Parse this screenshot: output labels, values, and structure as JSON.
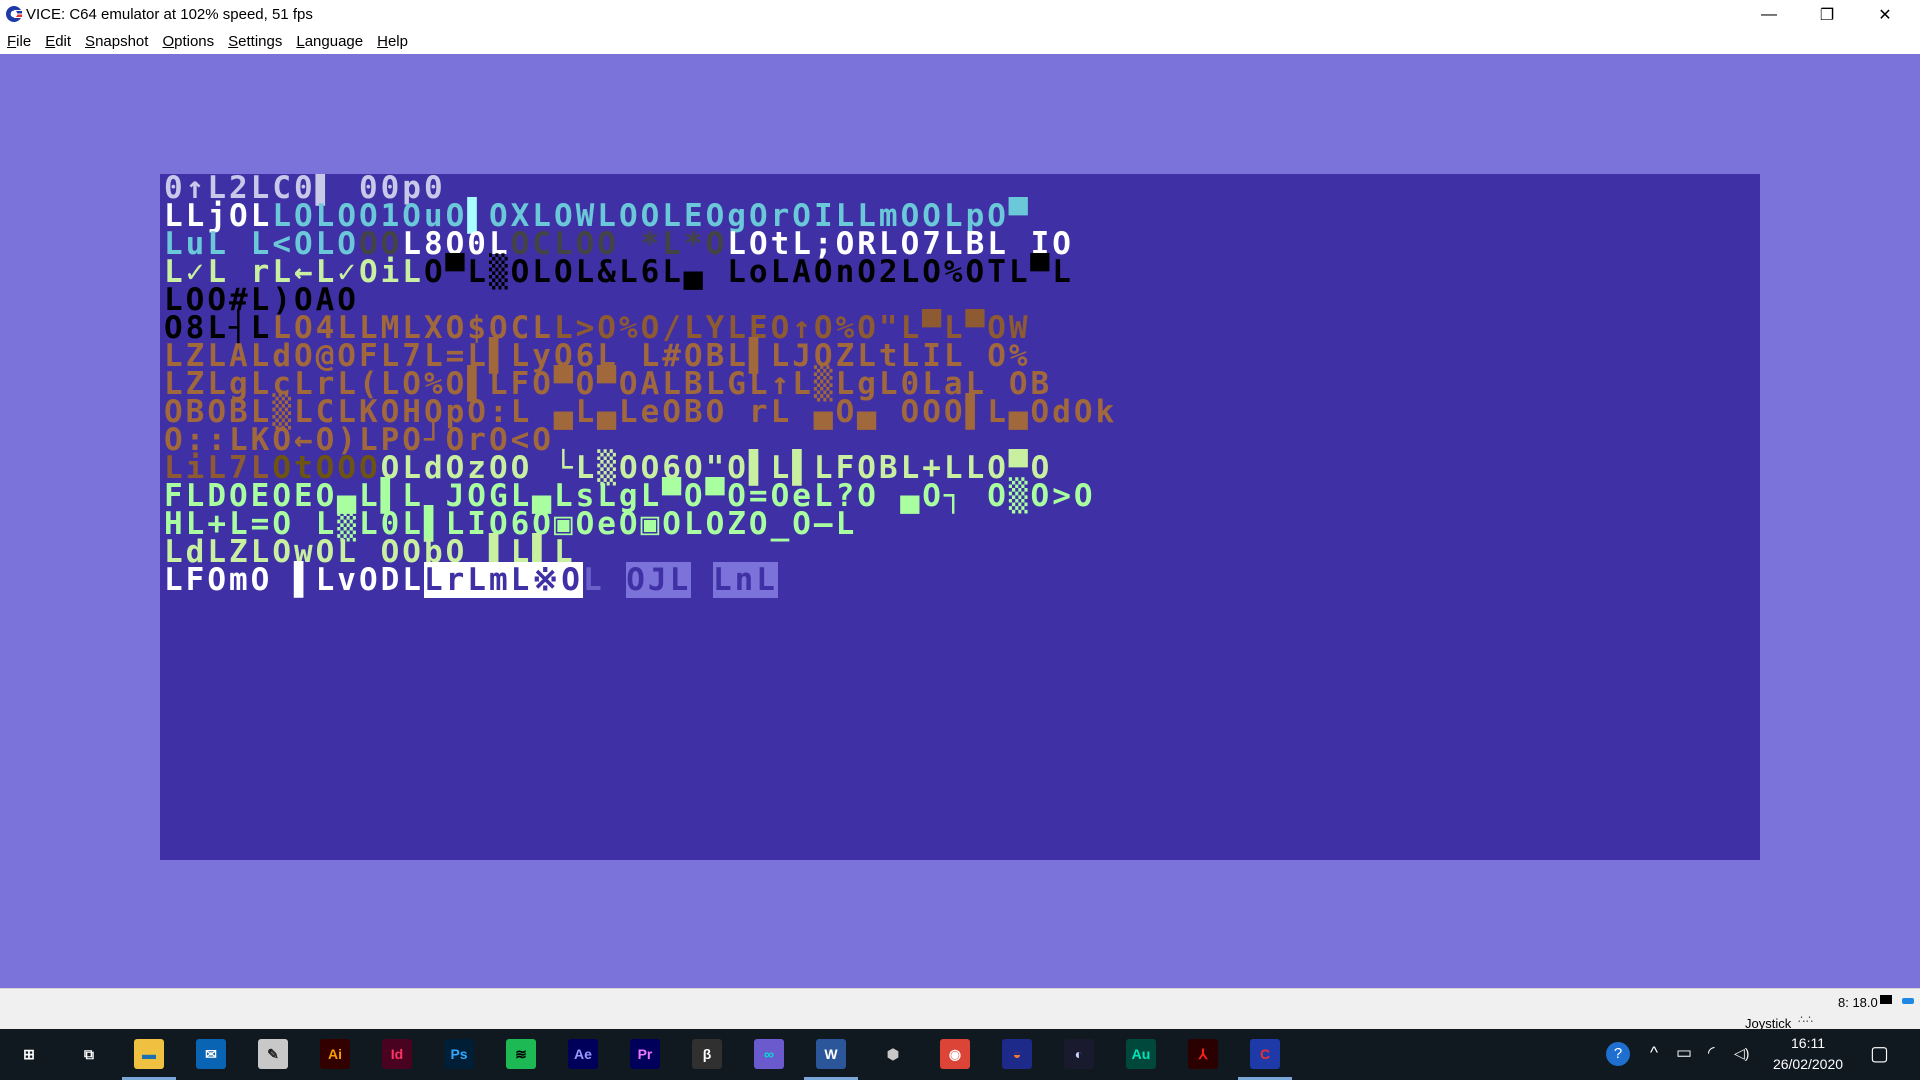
{
  "window": {
    "title": "VICE: C64 emulator at 102% speed, 51 fps",
    "icon": "vice-c64-icon",
    "controls": [
      "minimize-icon",
      "restore-icon",
      "close-icon"
    ],
    "minimize_glyph": "—",
    "restore_glyph": "❐",
    "close_glyph": "✕"
  },
  "menu": {
    "items": [
      "File",
      "Edit",
      "Snapshot",
      "Options",
      "Settings",
      "Language",
      "Help"
    ],
    "mnemonics": [
      "F",
      "E",
      "S",
      "O",
      "S",
      "L",
      "H"
    ]
  },
  "colors": {
    "border": "#7b72da",
    "screen_bg": "#3f31a5",
    "white": "#ffffff",
    "cyan": "#6ac8d8",
    "light_green": "#a9ff9f",
    "black": "#000000",
    "orange": "#a1683c",
    "brown": "#6d5412",
    "light_red": "#9a6759",
    "light_blue": "#9b8fef",
    "dark_gray": "#505050"
  },
  "c64_screen": {
    "rows": [
      [
        {
          "t": "0↑L2LC0▌ 00p0",
          "c": "#c8c8e8"
        }
      ],
      [
        {
          "t": "LL",
          "c": "#ffffff"
        },
        {
          "t": "jOL",
          "c": "#ffffff"
        },
        {
          "t": "LOLOO1OuO",
          "c": "#6ac8d8"
        },
        {
          "t": "▌",
          "c": "#a9ffff"
        },
        {
          "t": "OXLOWLOOLEOgOrOILLmOOLpO▀",
          "c": "#6ac8d8"
        }
      ],
      [
        {
          "t": "LuL L<OLO",
          "c": "#6ac8d8"
        },
        {
          "t": "OO",
          "c": "#444444"
        },
        {
          "t": "L8O0L",
          "c": "#ffffff"
        },
        {
          "t": "OCLOO *L*O",
          "c": "#444444"
        },
        {
          "t": "LOtL;ORLO7LBL IO",
          "c": "#ffffff"
        }
      ],
      [
        {
          "t": "L✓L rL←L✓OiL",
          "c": "#c8f0a0"
        },
        {
          "t": "O▀L▒OLOL&L6L▄ LoLAOnO2LO%OTL▀L",
          "c": "#000000"
        }
      ],
      [
        {
          "t": "LOO#L)OAO",
          "c": "#000000"
        }
      ],
      [
        {
          "t": "O8L┤L",
          "c": "#000000"
        },
        {
          "t": "LO4LLMLXO$OCL",
          "c": "#a1683c"
        },
        {
          "t": "L>O%O/LYLEO↑O%O\"L▀L▀OW",
          "c": "#8d5a32"
        }
      ],
      [
        {
          "t": "LZLALdO@OFL7L=L▌LyO6L L#OBL▌LJOZLtLIL O%",
          "c": "#a1683c"
        }
      ],
      [
        {
          "t": "LZLgLcLrL(LO%O▌LFO▀O▀OALBLGL↑L▒LgL0LaL OB",
          "c": "#a1683c"
        }
      ],
      [
        {
          "t": "OBOBL▒LCLKOHOpO:L ▄L▄LeOBO rL ▄O▄ OOO▌L▄OdOk",
          "c": "#a1683c"
        }
      ],
      [
        {
          "t": "O::LKO←O)LPO┘OrO<O",
          "c": "#a1683c"
        }
      ],
      [
        {
          "t": "LiL7L",
          "c": "#8d5a32"
        },
        {
          "t": "OtOOO",
          "c": "#6d5412"
        },
        {
          "t": "OLdOzOO └L▒OO6O\"O▌L▌LFOBL+LLO▀O",
          "c": "#c8f0a0"
        }
      ],
      [
        {
          "t": "FLDOEOEO▄L▌L JOGL▄LsLgL▀O▀O=OeL?O ▄O┐ O▒O>O",
          "c": "#a9ff9f"
        }
      ],
      [
        {
          "t": "HL+L=O L▒L0L▌LIO6O▣OeO▣OLOZO_O—L",
          "c": "#a9ff9f"
        }
      ],
      [
        {
          "t": "LdLZLOwOL OObO ▌L▌L",
          "c": "#c8f0a0"
        }
      ],
      [
        {
          "t": "LFOmO ▌LvODL",
          "c": "#ffffff"
        },
        {
          "t": "LrLmL※O",
          "c": "#3f31a5",
          "bg": "#ffffff"
        },
        {
          "t": "L ",
          "c": "#6a60c8"
        },
        {
          "t": "OJL",
          "c": "#3f31a5",
          "bg": "#7b72da"
        },
        {
          "t": " ",
          "c": "#6a60c8"
        },
        {
          "t": "LnL",
          "c": "#3f31a5",
          "bg": "#7b72da"
        }
      ]
    ]
  },
  "statusbar": {
    "speed_text": "8: 18.0",
    "joystick_label": "Joystick",
    "joy_dots": "∴∴"
  },
  "taskbar": {
    "apps": [
      {
        "name": "start-icon",
        "label": "⊞",
        "bg": "transparent",
        "fg": "#ffffff",
        "active": false
      },
      {
        "name": "task-view-icon",
        "label": "⧉",
        "bg": "transparent",
        "fg": "#ffffff",
        "active": false
      },
      {
        "name": "file-explorer-icon",
        "label": "▬",
        "bg": "#f0c040",
        "fg": "#1a70b0",
        "active": true
      },
      {
        "name": "mail-icon",
        "label": "✉",
        "bg": "#0a64b4",
        "fg": "#ffffff",
        "active": false
      },
      {
        "name": "app-wrench-icon",
        "label": "✎",
        "bg": "#c8c8c8",
        "fg": "#222222",
        "active": false
      },
      {
        "name": "illustrator-icon",
        "label": "Ai",
        "bg": "#330000",
        "fg": "#ff9a00",
        "active": false
      },
      {
        "name": "indesign-icon",
        "label": "Id",
        "bg": "#49021f",
        "fg": "#ff3366",
        "active": false
      },
      {
        "name": "photoshop-icon",
        "label": "Ps",
        "bg": "#001e36",
        "fg": "#31a8ff",
        "active": false
      },
      {
        "name": "spotify-icon",
        "label": "≋",
        "bg": "#1db954",
        "fg": "#000000",
        "active": false
      },
      {
        "name": "after-effects-icon",
        "label": "Ae",
        "bg": "#00005b",
        "fg": "#9999ff",
        "active": false
      },
      {
        "name": "premiere-icon",
        "label": "Pr",
        "bg": "#00005b",
        "fg": "#ea77ff",
        "active": false
      },
      {
        "name": "audacity-icon",
        "label": "β",
        "bg": "#303030",
        "fg": "#ffffff",
        "active": false
      },
      {
        "name": "arduino-icon",
        "label": "∞",
        "bg": "#6a5acd",
        "fg": "#00e0d0",
        "active": false
      },
      {
        "name": "word-icon",
        "label": "W",
        "bg": "#2b579a",
        "fg": "#ffffff",
        "active": true
      },
      {
        "name": "hexagon-app-icon",
        "label": "⬢",
        "bg": "transparent",
        "fg": "#c8c8c8",
        "active": false
      },
      {
        "name": "chrome-icon",
        "label": "◉",
        "bg": "#db4437",
        "fg": "#ffffff",
        "active": false
      },
      {
        "name": "blender-icon",
        "label": "◒",
        "bg": "#1e2a8a",
        "fg": "#f5792a",
        "active": false
      },
      {
        "name": "cinema4d-icon",
        "label": "◐",
        "bg": "#1a1a2e",
        "fg": "#c8d8ff",
        "active": false
      },
      {
        "name": "audition-icon",
        "label": "Au",
        "bg": "#00473c",
        "fg": "#00e4bb",
        "active": false
      },
      {
        "name": "acrobat-icon",
        "label": "⅄",
        "bg": "#2a0000",
        "fg": "#ff2020",
        "active": false
      },
      {
        "name": "vice-icon",
        "label": "C",
        "bg": "#1e3aa8",
        "fg": "#e83030",
        "active": true
      }
    ],
    "tray": {
      "help_icon": "?",
      "chevron_icon": "^",
      "battery_icon": "▭",
      "wifi_icon": "◜",
      "volume_icon": "◁)",
      "time": "16:11",
      "date": "26/02/2020",
      "notification_icon": "▢"
    }
  }
}
